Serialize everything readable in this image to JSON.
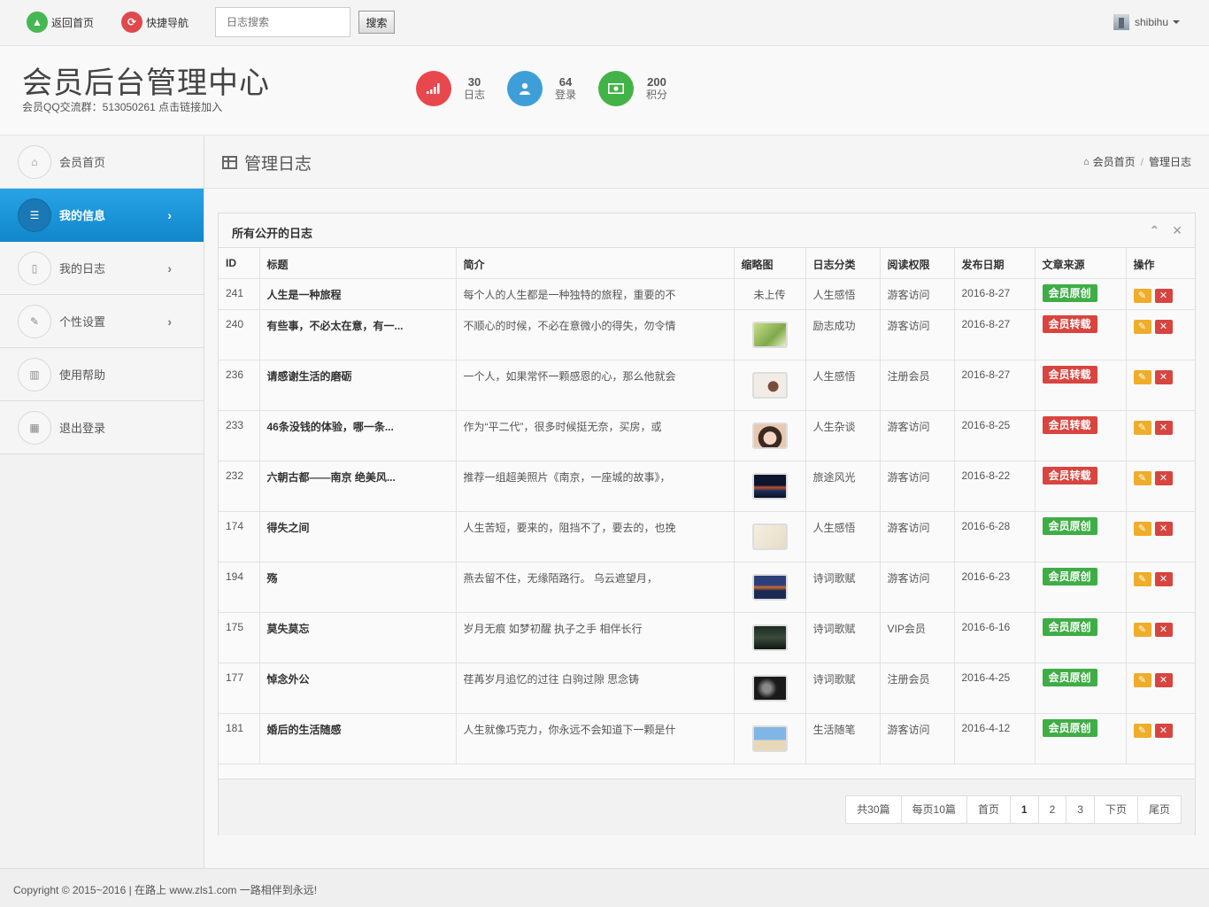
{
  "topbar": {
    "home_label": "返回首页",
    "quicknav_label": "快捷导航",
    "search_placeholder": "日志搜索",
    "search_button": "搜索",
    "username": "shibihu"
  },
  "header": {
    "title": "会员后台管理中心",
    "subtitle": "会员QQ交流群：513050261 点击链接加入",
    "stats": [
      {
        "num": "30",
        "label": "日志",
        "color": "#e8484d"
      },
      {
        "num": "64",
        "label": "登录",
        "color": "#3e9fd8"
      },
      {
        "num": "200",
        "label": "积分",
        "color": "#43b248"
      }
    ]
  },
  "sidebar": {
    "items": [
      {
        "label": "会员首页",
        "icon": "home-icon"
      },
      {
        "label": "我的信息",
        "icon": "list-icon",
        "active": true
      },
      {
        "label": "我的日志",
        "icon": "file-icon"
      },
      {
        "label": "个性设置",
        "icon": "wand-icon"
      },
      {
        "label": "使用帮助",
        "icon": "chart-icon"
      },
      {
        "label": "退出登录",
        "icon": "calendar-icon"
      }
    ]
  },
  "pagehead": {
    "title": "管理日志",
    "breadcrumb_home": "会员首页",
    "breadcrumb_current": "管理日志"
  },
  "panel": {
    "title": "所有公开的日志",
    "columns": [
      "ID",
      "标题",
      "简介",
      "缩略图",
      "日志分类",
      "阅读权限",
      "发布日期",
      "文章来源",
      "操作"
    ],
    "rows": [
      {
        "id": "241",
        "title": "人生是一种旅程",
        "intro": "每个人的人生都是一种独特的旅程，重要的不",
        "thumb": "未上传",
        "category": "人生感悟",
        "access": "游客访问",
        "date": "2016-8-27",
        "source": "会员原创",
        "source_type": "orig"
      },
      {
        "id": "240",
        "title": "有些事，不必太在意，有一...",
        "intro": "不顺心的时候，不必在意微小的得失，勿令情",
        "thumb": "thumb-green",
        "category": "励志成功",
        "access": "游客访问",
        "date": "2016-8-27",
        "source": "会员转载",
        "source_type": "repost"
      },
      {
        "id": "236",
        "title": "请感谢生活的磨砺",
        "intro": "一个人，如果常怀一颗感恩的心，那么他就会",
        "thumb": "thumb-vase",
        "category": "人生感悟",
        "access": "注册会员",
        "date": "2016-8-27",
        "source": "会员转载",
        "source_type": "repost"
      },
      {
        "id": "233",
        "title": "46条没钱的体验，哪一条...",
        "intro": "作为“平二代”，很多时候挺无奈，买房，或",
        "thumb": "thumb-cartoon",
        "category": "人生杂谈",
        "access": "游客访问",
        "date": "2016-8-25",
        "source": "会员转载",
        "source_type": "repost"
      },
      {
        "id": "232",
        "title": "六朝古都——南京 绝美风...",
        "intro": "推荐一组超美照片《南京，一座城的故事》，",
        "thumb": "thumb-night",
        "category": "旅途风光",
        "access": "游客访问",
        "date": "2016-8-22",
        "source": "会员转载",
        "source_type": "repost"
      },
      {
        "id": "174",
        "title": "得失之间",
        "intro": "人生苦短，要来的，阻挡不了，要去的，也挽",
        "thumb": "thumb-calligraphy",
        "category": "人生感悟",
        "access": "游客访问",
        "date": "2016-6-28",
        "source": "会员原创",
        "source_type": "orig"
      },
      {
        "id": "194",
        "title": "殇",
        "intro": "燕去留不住，无缘陌路行。 乌云遮望月，",
        "thumb": "thumb-bridge",
        "category": "诗词歌赋",
        "access": "游客访问",
        "date": "2016-6-23",
        "source": "会员原创",
        "source_type": "orig"
      },
      {
        "id": "175",
        "title": "莫失莫忘",
        "intro": "岁月无痕 如梦初醒 执子之手 相伴长行",
        "thumb": "thumb-dark",
        "category": "诗词歌赋",
        "access": "VIP会员",
        "date": "2016-6-16",
        "source": "会员原创",
        "source_type": "orig"
      },
      {
        "id": "177",
        "title": "悼念外公",
        "intro": "荏苒岁月追忆的过往 白驹过隙 思念铸",
        "thumb": "thumb-smoke",
        "category": "诗词歌赋",
        "access": "注册会员",
        "date": "2016-4-25",
        "source": "会员原创",
        "source_type": "orig"
      },
      {
        "id": "181",
        "title": "婚后的生活随感",
        "intro": "人生就像巧克力，你永远不会知道下一颗是什",
        "thumb": "thumb-couple",
        "category": "生活随笔",
        "access": "游客访问",
        "date": "2016-4-12",
        "source": "会员原创",
        "source_type": "orig"
      }
    ]
  },
  "pagination": {
    "total": "共30篇",
    "per_page": "每页10篇",
    "first": "首页",
    "pages": [
      "1",
      "2",
      "3"
    ],
    "current": "1",
    "next": "下页",
    "last": "尾页"
  },
  "footer": {
    "text": "Copyright © 2015~2016 | 在路上 www.zls1.com 一路相伴到永远!"
  }
}
